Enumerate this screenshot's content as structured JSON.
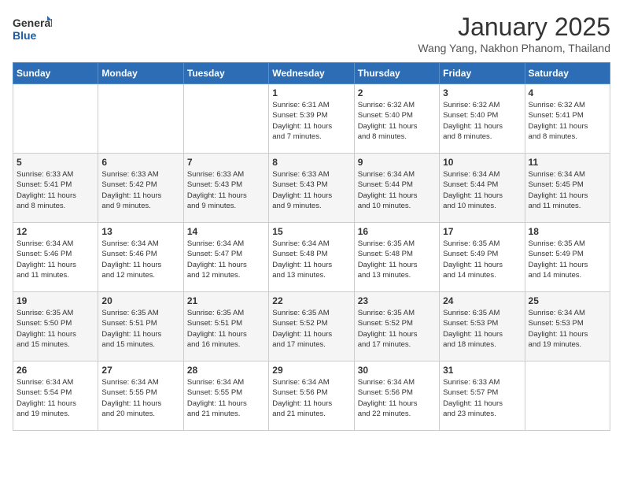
{
  "header": {
    "logo_line1": "General",
    "logo_line2": "Blue",
    "title": "January 2025",
    "subtitle": "Wang Yang, Nakhon Phanom, Thailand"
  },
  "weekdays": [
    "Sunday",
    "Monday",
    "Tuesday",
    "Wednesday",
    "Thursday",
    "Friday",
    "Saturday"
  ],
  "weeks": [
    [
      {
        "day": "",
        "info": ""
      },
      {
        "day": "",
        "info": ""
      },
      {
        "day": "",
        "info": ""
      },
      {
        "day": "1",
        "info": "Sunrise: 6:31 AM\nSunset: 5:39 PM\nDaylight: 11 hours\nand 7 minutes."
      },
      {
        "day": "2",
        "info": "Sunrise: 6:32 AM\nSunset: 5:40 PM\nDaylight: 11 hours\nand 8 minutes."
      },
      {
        "day": "3",
        "info": "Sunrise: 6:32 AM\nSunset: 5:40 PM\nDaylight: 11 hours\nand 8 minutes."
      },
      {
        "day": "4",
        "info": "Sunrise: 6:32 AM\nSunset: 5:41 PM\nDaylight: 11 hours\nand 8 minutes."
      }
    ],
    [
      {
        "day": "5",
        "info": "Sunrise: 6:33 AM\nSunset: 5:41 PM\nDaylight: 11 hours\nand 8 minutes."
      },
      {
        "day": "6",
        "info": "Sunrise: 6:33 AM\nSunset: 5:42 PM\nDaylight: 11 hours\nand 9 minutes."
      },
      {
        "day": "7",
        "info": "Sunrise: 6:33 AM\nSunset: 5:43 PM\nDaylight: 11 hours\nand 9 minutes."
      },
      {
        "day": "8",
        "info": "Sunrise: 6:33 AM\nSunset: 5:43 PM\nDaylight: 11 hours\nand 9 minutes."
      },
      {
        "day": "9",
        "info": "Sunrise: 6:34 AM\nSunset: 5:44 PM\nDaylight: 11 hours\nand 10 minutes."
      },
      {
        "day": "10",
        "info": "Sunrise: 6:34 AM\nSunset: 5:44 PM\nDaylight: 11 hours\nand 10 minutes."
      },
      {
        "day": "11",
        "info": "Sunrise: 6:34 AM\nSunset: 5:45 PM\nDaylight: 11 hours\nand 11 minutes."
      }
    ],
    [
      {
        "day": "12",
        "info": "Sunrise: 6:34 AM\nSunset: 5:46 PM\nDaylight: 11 hours\nand 11 minutes."
      },
      {
        "day": "13",
        "info": "Sunrise: 6:34 AM\nSunset: 5:46 PM\nDaylight: 11 hours\nand 12 minutes."
      },
      {
        "day": "14",
        "info": "Sunrise: 6:34 AM\nSunset: 5:47 PM\nDaylight: 11 hours\nand 12 minutes."
      },
      {
        "day": "15",
        "info": "Sunrise: 6:34 AM\nSunset: 5:48 PM\nDaylight: 11 hours\nand 13 minutes."
      },
      {
        "day": "16",
        "info": "Sunrise: 6:35 AM\nSunset: 5:48 PM\nDaylight: 11 hours\nand 13 minutes."
      },
      {
        "day": "17",
        "info": "Sunrise: 6:35 AM\nSunset: 5:49 PM\nDaylight: 11 hours\nand 14 minutes."
      },
      {
        "day": "18",
        "info": "Sunrise: 6:35 AM\nSunset: 5:49 PM\nDaylight: 11 hours\nand 14 minutes."
      }
    ],
    [
      {
        "day": "19",
        "info": "Sunrise: 6:35 AM\nSunset: 5:50 PM\nDaylight: 11 hours\nand 15 minutes."
      },
      {
        "day": "20",
        "info": "Sunrise: 6:35 AM\nSunset: 5:51 PM\nDaylight: 11 hours\nand 15 minutes."
      },
      {
        "day": "21",
        "info": "Sunrise: 6:35 AM\nSunset: 5:51 PM\nDaylight: 11 hours\nand 16 minutes."
      },
      {
        "day": "22",
        "info": "Sunrise: 6:35 AM\nSunset: 5:52 PM\nDaylight: 11 hours\nand 17 minutes."
      },
      {
        "day": "23",
        "info": "Sunrise: 6:35 AM\nSunset: 5:52 PM\nDaylight: 11 hours\nand 17 minutes."
      },
      {
        "day": "24",
        "info": "Sunrise: 6:35 AM\nSunset: 5:53 PM\nDaylight: 11 hours\nand 18 minutes."
      },
      {
        "day": "25",
        "info": "Sunrise: 6:34 AM\nSunset: 5:53 PM\nDaylight: 11 hours\nand 19 minutes."
      }
    ],
    [
      {
        "day": "26",
        "info": "Sunrise: 6:34 AM\nSunset: 5:54 PM\nDaylight: 11 hours\nand 19 minutes."
      },
      {
        "day": "27",
        "info": "Sunrise: 6:34 AM\nSunset: 5:55 PM\nDaylight: 11 hours\nand 20 minutes."
      },
      {
        "day": "28",
        "info": "Sunrise: 6:34 AM\nSunset: 5:55 PM\nDaylight: 11 hours\nand 21 minutes."
      },
      {
        "day": "29",
        "info": "Sunrise: 6:34 AM\nSunset: 5:56 PM\nDaylight: 11 hours\nand 21 minutes."
      },
      {
        "day": "30",
        "info": "Sunrise: 6:34 AM\nSunset: 5:56 PM\nDaylight: 11 hours\nand 22 minutes."
      },
      {
        "day": "31",
        "info": "Sunrise: 6:33 AM\nSunset: 5:57 PM\nDaylight: 11 hours\nand 23 minutes."
      },
      {
        "day": "",
        "info": ""
      }
    ]
  ]
}
